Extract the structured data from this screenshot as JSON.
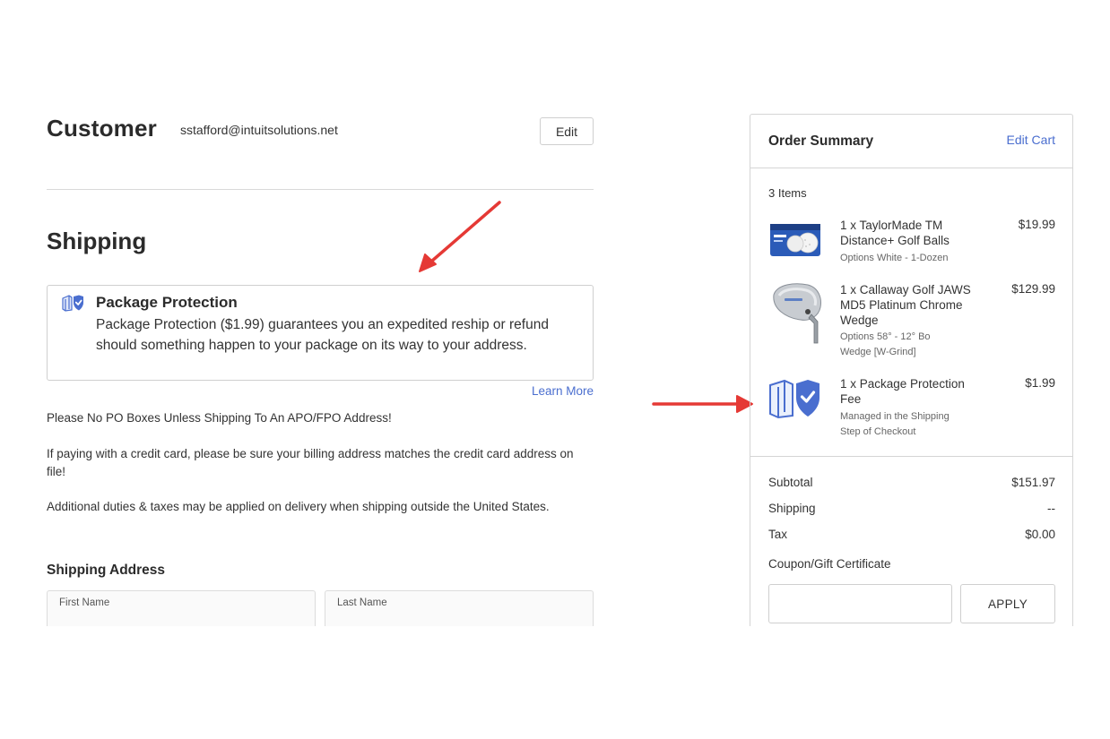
{
  "customer": {
    "title": "Customer",
    "email": "sstafford@intuitsolutions.net",
    "edit_label": "Edit"
  },
  "shipping": {
    "title": "Shipping",
    "package_protection": {
      "icon": "package-shield-icon",
      "title": "Package Protection",
      "description": "Package Protection ($1.99) guarantees you an expedited reship or refund should something happen to your package on its way to your address."
    },
    "learn_more": "Learn More",
    "notes": [
      "Please No PO Boxes Unless Shipping To An APO/FPO Address!",
      "If paying with a credit card, please be sure your billing address matches the credit card address on file!",
      "Additional duties & taxes may be applied on delivery when shipping outside the United States."
    ],
    "address": {
      "title": "Shipping Address",
      "first_name_label": "First Name",
      "last_name_label": "Last Name"
    }
  },
  "annotations": {
    "arrow_color": "#e53935"
  },
  "order_summary": {
    "title": "Order Summary",
    "edit_cart": "Edit Cart",
    "items_count": "3 Items",
    "items": [
      {
        "name": "1 x TaylorMade TM Distance+ Golf Balls",
        "options": [
          "Options White - 1-Dozen"
        ],
        "price": "$19.99",
        "thumb": "golf-balls-image"
      },
      {
        "name": "1 x Callaway Golf JAWS MD5 Platinum Chrome Wedge",
        "options": [
          "Options 58° - 12° Bo",
          "Wedge [W-Grind]"
        ],
        "price": "$129.99",
        "thumb": "wedge-image"
      },
      {
        "name": "1 x Package Protection Fee",
        "options": [
          "Managed in the Shipping",
          "Step of Checkout"
        ],
        "price": "$1.99",
        "thumb": "package-shield-icon"
      }
    ],
    "totals": {
      "subtotal_label": "Subtotal",
      "subtotal_value": "$151.97",
      "shipping_label": "Shipping",
      "shipping_value": "--",
      "tax_label": "Tax",
      "tax_value": "$0.00"
    },
    "coupon_label": "Coupon/Gift Certificate",
    "coupon_placeholder": "",
    "apply_label": "APPLY"
  }
}
